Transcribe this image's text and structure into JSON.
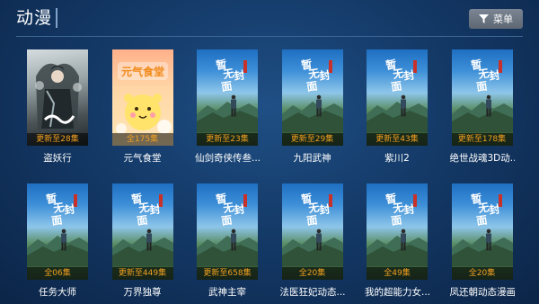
{
  "header": {
    "title": "动漫",
    "menu_label": "菜单",
    "menu_icon": "filter-icon"
  },
  "cover_text": {
    "line1": "暂",
    "line2": "无",
    "line3": "封",
    "line4": "面"
  },
  "yqst_cover_title": "元气食堂",
  "items": [
    {
      "name": "盗妖行",
      "status": "更新至28集",
      "cover": "dyx"
    },
    {
      "name": "元气食堂",
      "status": "全175集",
      "cover": "yqst"
    },
    {
      "name": "仙剑奇侠传叁...",
      "status": "更新至23集",
      "cover": "default"
    },
    {
      "name": "九阳武神",
      "status": "更新至29集",
      "cover": "default"
    },
    {
      "name": "紫川2",
      "status": "更新至43集",
      "cover": "default"
    },
    {
      "name": "绝世战魂3D动...",
      "status": "更新至178集",
      "cover": "default"
    },
    {
      "name": "任务大师",
      "status": "全06集",
      "cover": "default"
    },
    {
      "name": "万界独尊",
      "status": "更新至449集",
      "cover": "default"
    },
    {
      "name": "武神主宰",
      "status": "更新至658集",
      "cover": "default"
    },
    {
      "name": "法医狂妃动态...",
      "status": "全20集",
      "cover": "default"
    },
    {
      "name": "我的超能力女...",
      "status": "全49集",
      "cover": "default"
    },
    {
      "name": "凤还朝动态漫画",
      "status": "全20集",
      "cover": "default"
    }
  ]
}
